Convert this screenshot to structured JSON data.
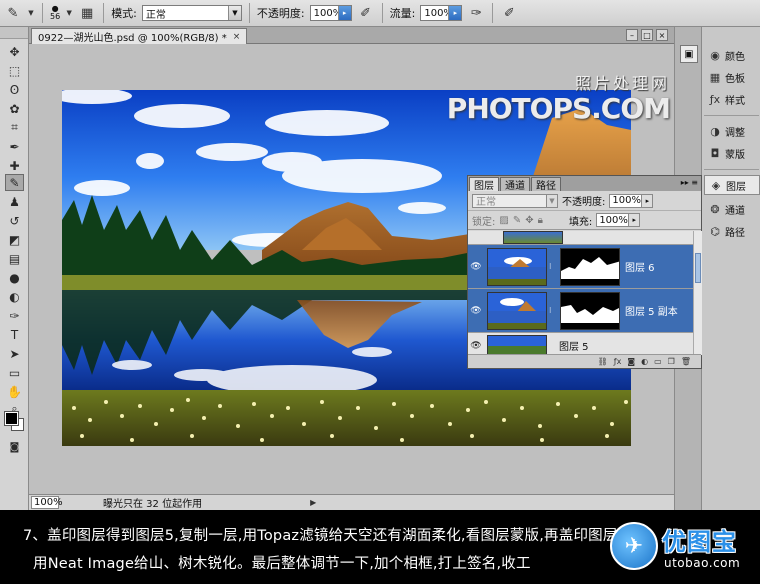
{
  "options_bar": {
    "brush_size": "56",
    "mode_label": "模式:",
    "mode_value": "正常",
    "opacity_label": "不透明度:",
    "opacity_value": "100%",
    "flow_label": "流量:",
    "flow_value": "100%"
  },
  "document": {
    "tab_title": "0922—湖光山色.psd @ 100%(RGB/8) *",
    "close_label": "×",
    "watermark_cn": "照片处理网",
    "watermark_en": "PHOTOPS.COM",
    "zoom_value": "100%",
    "status_text": "曝光只在 32 位起作用"
  },
  "right_dock": {
    "panels": [
      {
        "label": "颜色",
        "icon": "palette-icon"
      },
      {
        "label": "色板",
        "icon": "swatches-icon"
      },
      {
        "label": "样式",
        "icon": "styles-icon"
      },
      {
        "label": "调整",
        "icon": "adjustments-icon"
      },
      {
        "label": "蒙版",
        "icon": "masks-icon"
      },
      {
        "label": "图层",
        "icon": "layers-icon"
      },
      {
        "label": "通道",
        "icon": "channels-icon"
      },
      {
        "label": "路径",
        "icon": "paths-icon"
      }
    ]
  },
  "layers_panel": {
    "tabs": [
      "图层",
      "通道",
      "路径"
    ],
    "blend_mode": "正常",
    "opacity_label": "不透明度:",
    "opacity_value": "100%",
    "lock_label": "锁定:",
    "fill_label": "填充:",
    "fill_value": "100%",
    "layers": [
      {
        "name": "图层 6",
        "selected": true
      },
      {
        "name": "图层 5 副本",
        "selected": true
      },
      {
        "name": "图层 5",
        "selected": false
      }
    ]
  },
  "caption": {
    "line1": "7、盖印图层得到图层5,复制一层,用Topaz滤镜给天空还有湖面柔化,看图层蒙版,再盖印图层",
    "line2": "用Neat Image给山、树木锐化。最后整体调节一下,加个相框,打上签名,收工"
  },
  "logo": {
    "cn": "优图宝",
    "en": "utobao.com"
  }
}
